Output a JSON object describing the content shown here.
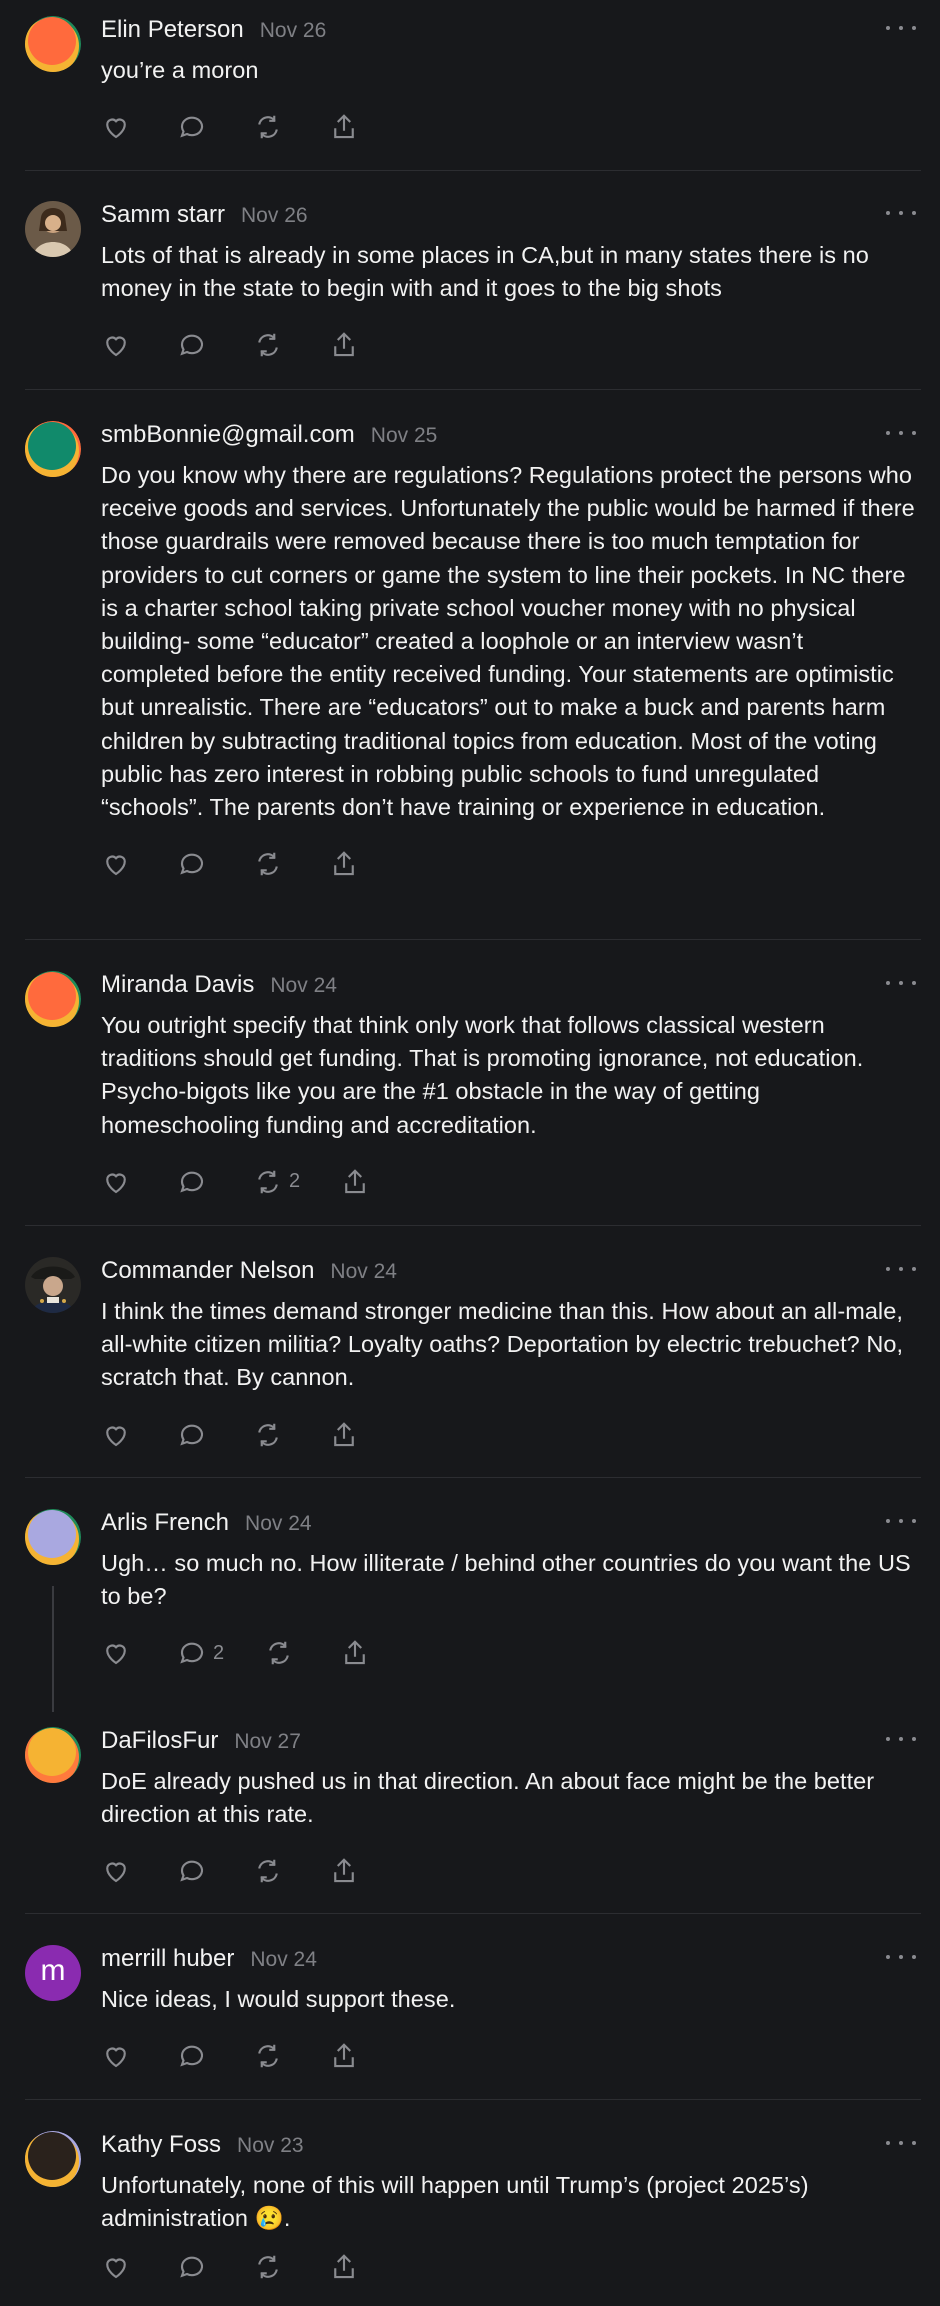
{
  "colors": {
    "background": "#17181b",
    "text": "#f2f2f2",
    "muted": "#7f8085",
    "divider": "#2c2d31"
  },
  "posts": [
    {
      "author": "Elin Peterson",
      "date": "Nov 26",
      "text": "you’re a moron",
      "avatar": "gradient-orange-avatar",
      "reposts": "",
      "replies": ""
    },
    {
      "author": "Samm starr",
      "date": "Nov 26",
      "text": "Lots of that is already in some places in CA,but in many states there is no money in the state to begin with and it goes to the big shots",
      "avatar": "photo-avatar",
      "reposts": "",
      "replies": ""
    },
    {
      "author": "smbBonnie@gmail.com",
      "date": "Nov 25",
      "text": "Do you know why there are regulations? Regulations protect the persons who receive goods and services. Unfortunately the public would be harmed if there those guardrails were removed because there is too much temptation for providers to cut corners or game the system to line their pockets. In NC there is a charter school taking private school voucher money with no physical building- some “educator” created a loophole or an interview wasn’t completed before the entity received funding. Your statements are optimistic but unrealistic. There are “educators” out to make a buck and parents harm children by subtracting traditional topics from education. Most of the voting public has zero interest in robbing public schools to fund unregulated “schools”. The parents don’t have training or experience in education.",
      "avatar": "gradient-teal-avatar",
      "reposts": "",
      "replies": ""
    },
    {
      "author": "Miranda Davis",
      "date": "Nov 24",
      "text": "You outright specify that think only work that follows classical western traditions should get funding. That is promoting ignorance, not education. Psycho-bigots like you are the #1 obstacle in the way of getting homeschooling funding and accreditation.",
      "avatar": "gradient-orange-avatar",
      "reposts": "2",
      "replies": ""
    },
    {
      "author": "Commander Nelson",
      "date": "Nov 24",
      "text": "I think the times demand stronger medicine than this. How about an all-male, all-white citizen militia? Loyalty oaths? Deportation by electric trebuchet? No, scratch that. By cannon.",
      "avatar": "portrait-avatar",
      "reposts": "",
      "replies": ""
    },
    {
      "author": "Arlis French",
      "date": "Nov 24",
      "text": "Ugh… so much no. How illiterate / behind other countries do you want the US to be?",
      "avatar": "gradient-lavender-avatar",
      "reposts": "",
      "replies": "2"
    },
    {
      "author": "DaFilosFur",
      "date": "Nov 27",
      "text": "DoE already pushed us in that direction. An about face might be the better direction at this rate.",
      "avatar": "gradient-yellow-avatar",
      "reposts": "",
      "replies": ""
    },
    {
      "author": "merrill huber",
      "date": "Nov 24",
      "text": "Nice ideas, I would support these.",
      "avatar": "letter-avatar",
      "avatar_letter": "m",
      "reposts": "",
      "replies": ""
    },
    {
      "author": "Kathy Foss",
      "date": "Nov 23",
      "text": "Unfortunately, none of this will happen until Trump’s (project 2025’s) administration",
      "emoji": "😢",
      "text_end": ".",
      "avatar": "gradient-dark-avatar",
      "reposts": "",
      "replies": ""
    }
  ]
}
